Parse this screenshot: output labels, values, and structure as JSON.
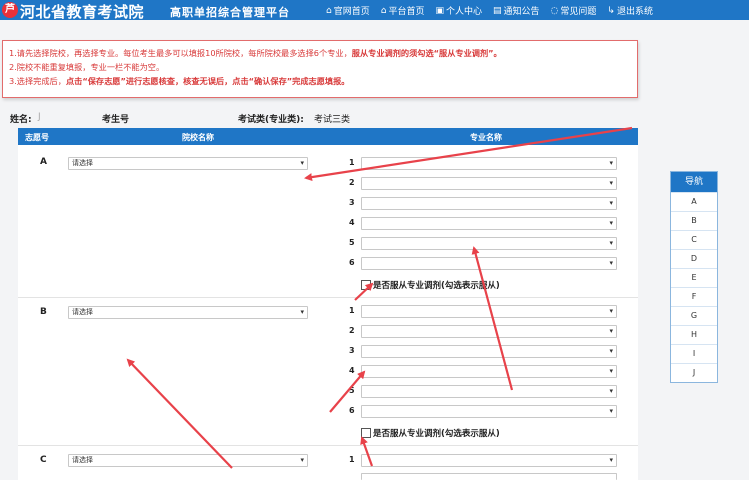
{
  "header": {
    "site_title": "河北省教育考试院",
    "site_subtitle": "高职单招综合管理平台",
    "logo_glyph": "芦",
    "nav": [
      {
        "icon": "⌂",
        "label": "官网首页"
      },
      {
        "icon": "⌂",
        "label": "平台首页"
      },
      {
        "icon": "▣",
        "label": "个人中心"
      },
      {
        "icon": "▤",
        "label": "通知公告"
      },
      {
        "icon": "◌",
        "label": "常见问题"
      },
      {
        "icon": "↳",
        "label": "退出系统"
      }
    ]
  },
  "notice": {
    "line1_a": "1.请先选择院校，再选择专业。每位考生最多可以填报10所院校，每所院校最多选择6个专业，",
    "line1_b": "服从专业调剂的须勾选“服从专业调剂”。",
    "line2": "2.院校不能重复填报，专业一栏不能为空。",
    "line3_a": "3.选择完成后，",
    "line3_b": "点击“保存志愿”进行志愿核查，核查无误后，点击“确认保存”完成志愿填报。"
  },
  "info": {
    "name_label": "姓名:",
    "name_value": "J",
    "exam_no_label": "考生号",
    "category_label": "考试类(专业类):",
    "category_value": "考试三类"
  },
  "table": {
    "col_no": "志愿号",
    "col_school": "院校名称",
    "col_major": "专业名称",
    "select_placeholder": "请选择",
    "major_numbers": [
      "1",
      "2",
      "3",
      "4",
      "5",
      "6"
    ],
    "adjust_label": "是否服从专业调剂(勾选表示服从)",
    "rows": [
      {
        "label": "A"
      },
      {
        "label": "B"
      },
      {
        "label": "C"
      }
    ]
  },
  "sidenav": {
    "title": "导航",
    "items": [
      "A",
      "B",
      "C",
      "D",
      "E",
      "F",
      "G",
      "H",
      "I",
      "J"
    ]
  },
  "colors": {
    "primary": "#1f76c6",
    "notice_red": "#d83a3a",
    "annotation_arrow": "#e8424a"
  }
}
